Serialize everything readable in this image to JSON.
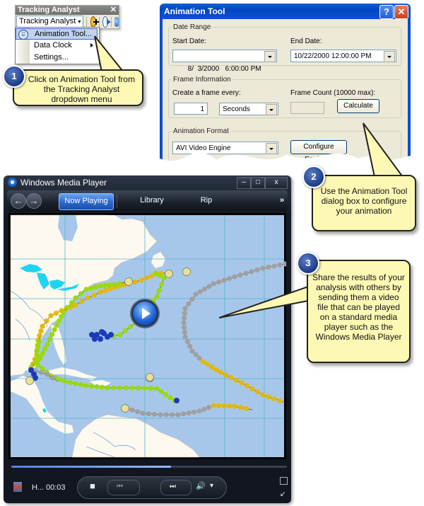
{
  "tracking_analyst": {
    "toolbar_title": "Tracking Analyst",
    "close_glyph": "✕",
    "dropdown_label": "Tracking Analyst",
    "dropdown_arrow": "▾",
    "icons": [
      "add-temporal-data-icon",
      "playback-manager-icon",
      "tracking-server-icon"
    ],
    "menu": [
      {
        "label": "Animation Tool...",
        "highlighted": true,
        "icon": "animation-tool-icon"
      },
      {
        "label": "Data Clock",
        "submenu": true
      },
      {
        "label": "Settings..."
      }
    ]
  },
  "callouts": [
    {
      "number": "1",
      "text": "Click on Animation Tool from the Tracking Analyst dropdown menu"
    },
    {
      "number": "2",
      "text": "Use the Animation Tool dialog box to configure your animation"
    },
    {
      "number": "3",
      "text": "Share the results of your analysis with others by sending them a video file that can be played on a standard media player such as the Windows Media Player"
    }
  ],
  "animation_tool": {
    "title": "Animation Tool",
    "help_glyph": "?",
    "close_glyph": "✕",
    "date_range": {
      "legend": "Date Range",
      "start_label": "Start Date:",
      "start_value": "8/  3/2000   6:00:00 PM",
      "end_label": "End Date:",
      "end_value": "10/22/2000 12:00:00 PM"
    },
    "frame_info": {
      "legend": "Frame Information",
      "every_label": "Create a frame every:",
      "every_value": "1",
      "unit_value": "Seconds",
      "count_label": "Frame Count (10000 max):",
      "count_value": "",
      "calculate_label": "Calculate"
    },
    "format": {
      "legend": "Animation Format",
      "engine_value": "AVI Video Engine",
      "configure_label": "Configure Engine..."
    }
  },
  "media_player": {
    "title": "Windows Media Player",
    "window_buttons": [
      "–",
      "□",
      "x"
    ],
    "back_glyph": "←",
    "forward_glyph": "→",
    "tabs": [
      {
        "label": "Now Playing",
        "active": true
      },
      {
        "label": "Library",
        "active": false
      },
      {
        "label": "Rip",
        "active": false
      }
    ],
    "more_glyph": "»",
    "now_playing_title": "H...",
    "elapsed": "00:03",
    "seek_progress": 0.58,
    "controls": {
      "stop": "■",
      "previous": "⏮",
      "next": "⏭",
      "volume": "🔊",
      "volume_menu": "▾"
    },
    "map": {
      "ocean_color": "#a7c7ea",
      "land_color": "#fdf9ef",
      "grid_color": "#4fb5cf",
      "lake_color": "#1fd4f0",
      "track_colors": {
        "green": "#9ada0a",
        "gold": "#e5b800",
        "gray": "#a0a0a0",
        "blue": "#1c3ab8",
        "start": "#e6e290"
      }
    }
  }
}
